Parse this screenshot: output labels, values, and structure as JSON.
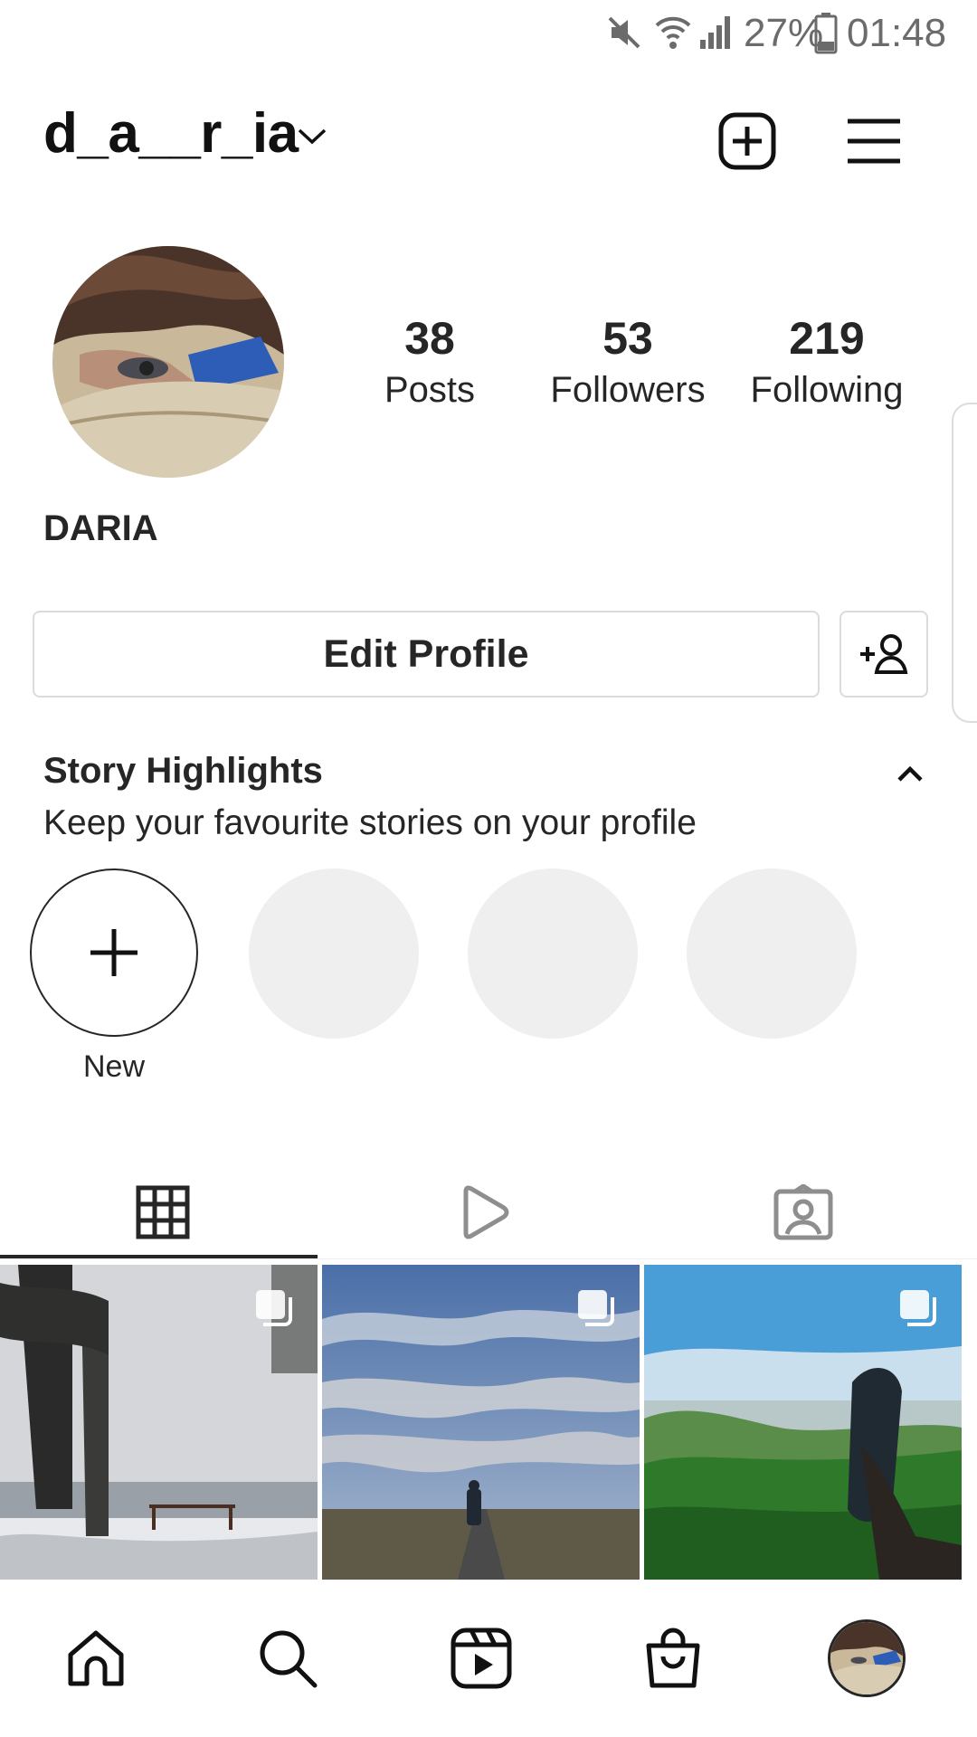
{
  "status_bar": {
    "battery": "27%",
    "time": "01:48",
    "icons": [
      "mute-icon",
      "wifi-icon",
      "signal-icon",
      "battery-icon"
    ]
  },
  "header": {
    "username": "d_a__r_ia",
    "icons": [
      "chevron-down-icon",
      "new-post-icon",
      "menu-icon"
    ]
  },
  "profile": {
    "posts_count": "38",
    "posts_label": "Posts",
    "followers_count": "53",
    "followers_label": "Followers",
    "following_count": "219",
    "following_label": "Following",
    "full_name": "DARIA",
    "edit_profile_label": "Edit Profile"
  },
  "highlights": {
    "title": "Story Highlights",
    "subtitle": "Keep your favourite stories on your profile",
    "new_label": "New"
  },
  "tabs": [
    "grid-icon",
    "reels-icon",
    "tagged-icon"
  ],
  "bottom_nav": [
    "home-icon",
    "search-icon",
    "reels-icon",
    "shop-icon",
    "profile-avatar"
  ],
  "colors": {
    "text": "#262626",
    "border": "#dbdbdb",
    "placeholder": "#efefef",
    "status": "#6b6b6b"
  }
}
